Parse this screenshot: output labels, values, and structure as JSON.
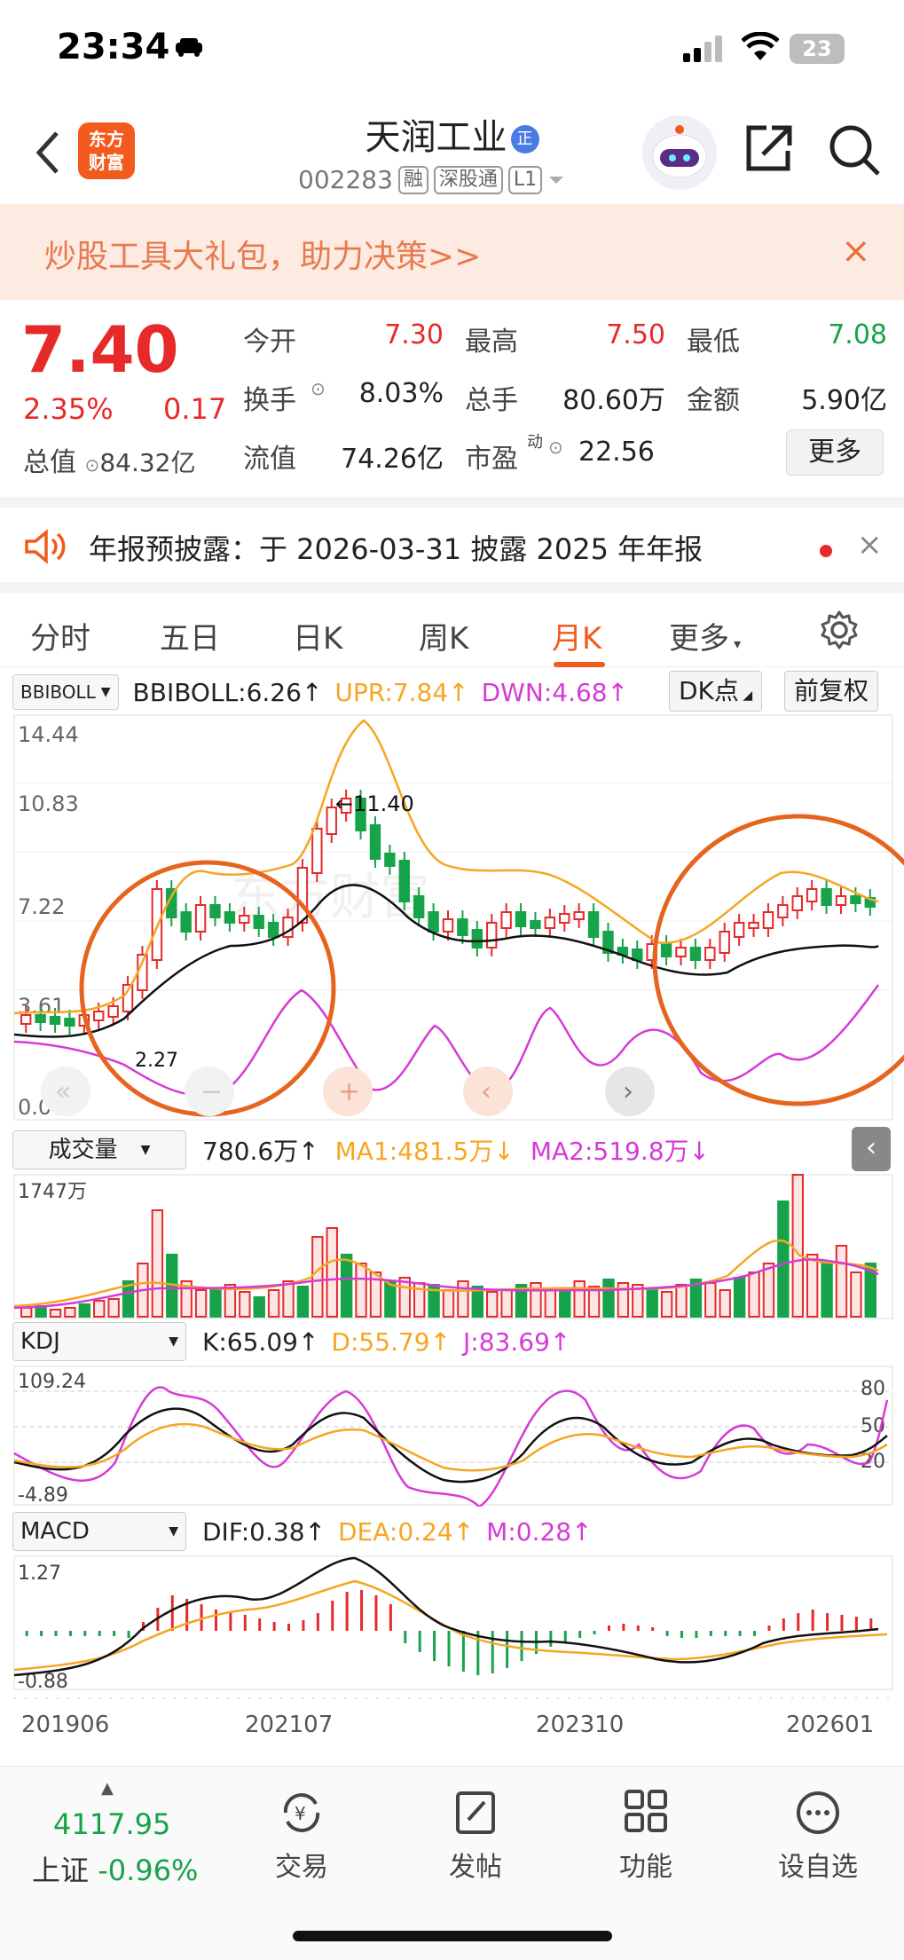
{
  "status_bar": {
    "time": "23:34",
    "battery": "23"
  },
  "header": {
    "stock_name": "天润工业",
    "badge": "正",
    "code": "002283",
    "tags": [
      "融",
      "深股通",
      "L1"
    ],
    "logo_text": "东方\n财富"
  },
  "banner": {
    "text": "炒股工具大礼包，助力决策>>",
    "close": "×"
  },
  "quote": {
    "price": "7.40",
    "change_pct": "2.35%",
    "change": "0.17",
    "market_cap_label": "总值",
    "market_cap": "84.32亿",
    "fields": [
      {
        "label": "今开",
        "value": "7.30",
        "color": "#e62a2a"
      },
      {
        "label": "最高",
        "value": "7.50",
        "color": "#e62a2a"
      },
      {
        "label": "最低",
        "value": "7.08",
        "color": "#17a34a"
      },
      {
        "label": "换手",
        "value": "8.03%",
        "color": "#222"
      },
      {
        "label": "总手",
        "value": "80.60万",
        "color": "#222"
      },
      {
        "label": "金额",
        "value": "5.90亿",
        "color": "#222"
      },
      {
        "label": "流值",
        "value": "74.26亿",
        "color": "#222"
      },
      {
        "label": "市盈",
        "value": "22.56",
        "color": "#222"
      }
    ],
    "pe_sup": "动",
    "more": "更多"
  },
  "notice": {
    "text": "年报预披露：于 2026-03-31 披露 2025 年年报",
    "close": "×"
  },
  "tabs": [
    "分时",
    "五日",
    "日K",
    "周K",
    "月K",
    "更多"
  ],
  "active_tab": "月K",
  "kline": {
    "indicator": "BBIBOLL",
    "bbiboll": "BBIBOLL:6.26↑",
    "upr": "UPR:7.84↑",
    "dwn": "DWN:4.68↑",
    "dk": "DK点",
    "fq": "前复权",
    "y_ticks": [
      "14.44",
      "10.83",
      "7.22",
      "3.61",
      "0.00"
    ],
    "high_label": "←11.40",
    "low_label": "2.27",
    "watermark": "东方财富",
    "nav_icons": [
      "«",
      "−",
      "+",
      "‹",
      "›"
    ]
  },
  "volume": {
    "indicator": "成交量",
    "value": "780.6万↑",
    "ma1": "MA1:481.5万↓",
    "ma2": "MA2:519.8万↓",
    "y_top": "1747万"
  },
  "kdj": {
    "indicator": "KDJ",
    "k": "K:65.09↑",
    "d": "D:55.79↑",
    "j": "J:83.69↑",
    "y_top": "109.24",
    "y_bottom": "-4.89",
    "levels": [
      "80",
      "50",
      "20"
    ]
  },
  "macd": {
    "indicator": "MACD",
    "dif": "DIF:0.38↑",
    "dea": "DEA:0.24↑",
    "m": "M:0.28↑",
    "y_top": "1.27",
    "y_bottom": "-0.88",
    "x_labels": [
      "201906",
      "202107",
      "202310",
      "202601"
    ]
  },
  "bottom_nav": {
    "index_value": "4117.95",
    "index_name": "上证",
    "index_change": "-0.96%",
    "items": [
      "交易",
      "发帖",
      "功能",
      "设自选"
    ]
  },
  "colors": {
    "up": "#e62a2a",
    "down": "#17a34a",
    "accent": "#f25a1e",
    "upr": "#f5a623",
    "dwn": "#d63ad6"
  }
}
